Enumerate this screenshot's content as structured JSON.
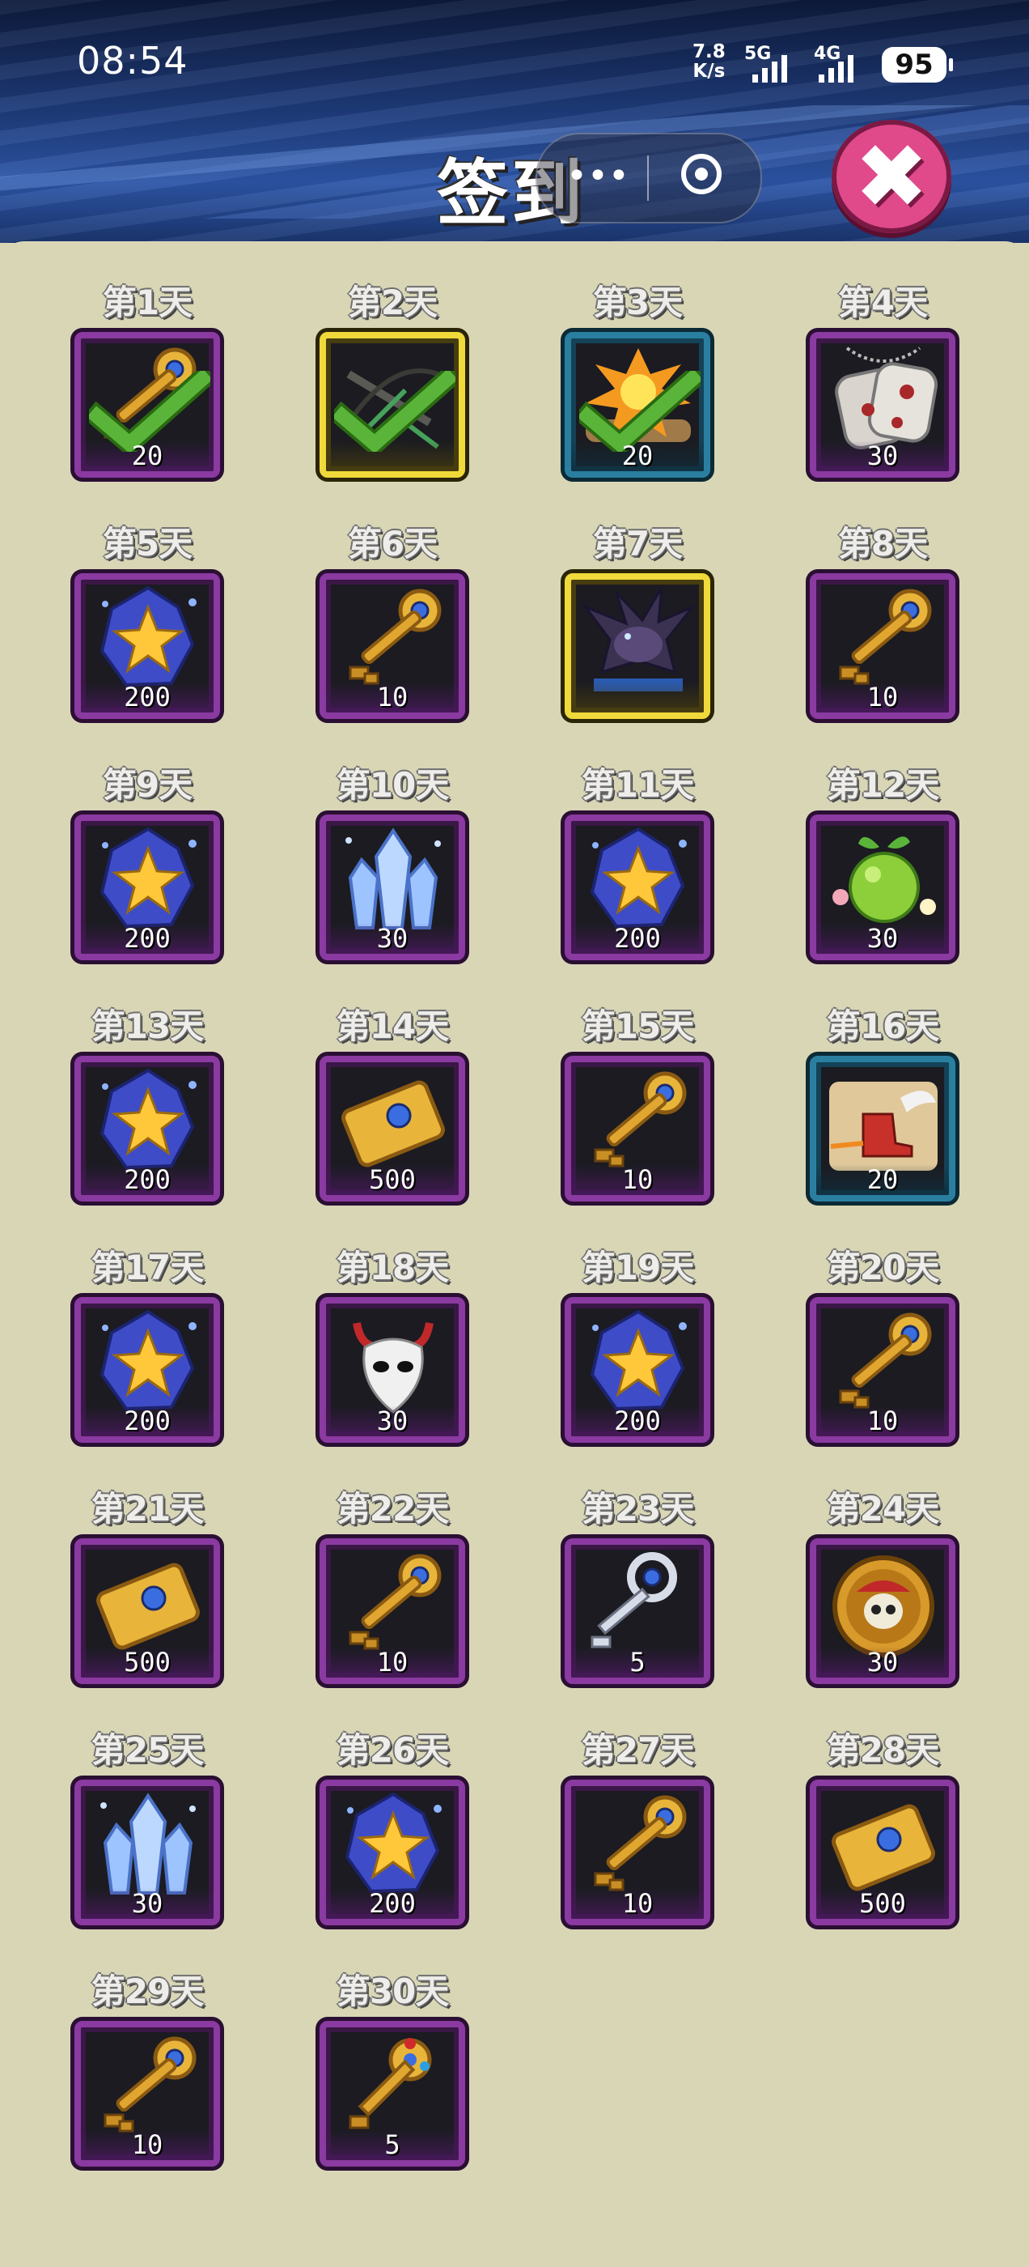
{
  "status": {
    "time": "08:54",
    "net_speed_top": "7.8",
    "net_speed_unit": "K/s",
    "sig1": "5G",
    "sig2": "4G",
    "battery": "95"
  },
  "header": {
    "title": "签到"
  },
  "colors": {
    "panel": "#d9d6b6",
    "frame_purple": "#8a3aa0",
    "frame_gold": "#f0d93a",
    "frame_blue": "#2a7fa0",
    "close": "#e0498a",
    "check": "#5ab43a"
  },
  "days": [
    {
      "label": "第1天",
      "item": "golden-key",
      "qty": "20",
      "claimed": true,
      "frame": "purple"
    },
    {
      "label": "第2天",
      "item": "crossbow",
      "qty": "",
      "claimed": true,
      "frame": "gold"
    },
    {
      "label": "第3天",
      "item": "explosion-scroll",
      "qty": "20",
      "claimed": true,
      "frame": "blue"
    },
    {
      "label": "第4天",
      "item": "dog-tag",
      "qty": "30",
      "claimed": false,
      "frame": "purple"
    },
    {
      "label": "第5天",
      "item": "star-crystal",
      "qty": "200",
      "claimed": false,
      "frame": "purple"
    },
    {
      "label": "第6天",
      "item": "golden-key",
      "qty": "10",
      "claimed": false,
      "frame": "purple"
    },
    {
      "label": "第7天",
      "item": "dragon",
      "qty": "",
      "claimed": false,
      "frame": "gold"
    },
    {
      "label": "第8天",
      "item": "golden-key",
      "qty": "10",
      "claimed": false,
      "frame": "purple"
    },
    {
      "label": "第9天",
      "item": "star-crystal",
      "qty": "200",
      "claimed": false,
      "frame": "purple"
    },
    {
      "label": "第10天",
      "item": "ice-crystal",
      "qty": "30",
      "claimed": false,
      "frame": "purple"
    },
    {
      "label": "第11天",
      "item": "star-crystal",
      "qty": "200",
      "claimed": false,
      "frame": "purple"
    },
    {
      "label": "第12天",
      "item": "green-fruit",
      "qty": "30",
      "claimed": false,
      "frame": "purple"
    },
    {
      "label": "第13天",
      "item": "star-crystal",
      "qty": "200",
      "claimed": false,
      "frame": "purple"
    },
    {
      "label": "第14天",
      "item": "gold-ticket",
      "qty": "500",
      "claimed": false,
      "frame": "purple"
    },
    {
      "label": "第15天",
      "item": "golden-key",
      "qty": "10",
      "claimed": false,
      "frame": "purple"
    },
    {
      "label": "第16天",
      "item": "boot-scroll",
      "qty": "20",
      "claimed": false,
      "frame": "blue"
    },
    {
      "label": "第17天",
      "item": "star-crystal",
      "qty": "200",
      "claimed": false,
      "frame": "purple"
    },
    {
      "label": "第18天",
      "item": "demon-mask",
      "qty": "30",
      "claimed": false,
      "frame": "purple"
    },
    {
      "label": "第19天",
      "item": "star-crystal",
      "qty": "200",
      "claimed": false,
      "frame": "purple"
    },
    {
      "label": "第20天",
      "item": "golden-key",
      "qty": "10",
      "claimed": false,
      "frame": "purple"
    },
    {
      "label": "第21天",
      "item": "gold-ticket",
      "qty": "500",
      "claimed": false,
      "frame": "purple"
    },
    {
      "label": "第22天",
      "item": "golden-key",
      "qty": "10",
      "claimed": false,
      "frame": "purple"
    },
    {
      "label": "第23天",
      "item": "silver-key",
      "qty": "5",
      "claimed": false,
      "frame": "purple"
    },
    {
      "label": "第24天",
      "item": "pirate-coin",
      "qty": "30",
      "claimed": false,
      "frame": "purple"
    },
    {
      "label": "第25天",
      "item": "ice-crystal",
      "qty": "30",
      "claimed": false,
      "frame": "purple"
    },
    {
      "label": "第26天",
      "item": "star-crystal",
      "qty": "200",
      "claimed": false,
      "frame": "purple"
    },
    {
      "label": "第27天",
      "item": "golden-key",
      "qty": "10",
      "claimed": false,
      "frame": "purple"
    },
    {
      "label": "第28天",
      "item": "gold-ticket",
      "qty": "500",
      "claimed": false,
      "frame": "purple"
    },
    {
      "label": "第29天",
      "item": "golden-key",
      "qty": "10",
      "claimed": false,
      "frame": "purple"
    },
    {
      "label": "第30天",
      "item": "jeweled-key",
      "qty": "5",
      "claimed": false,
      "frame": "purple"
    }
  ]
}
